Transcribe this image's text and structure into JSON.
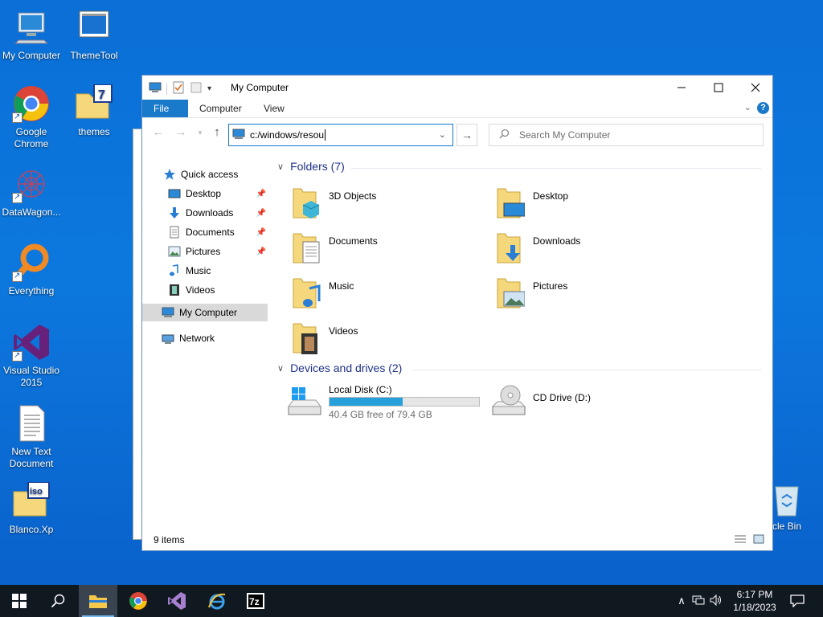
{
  "desktop": {
    "icons": [
      {
        "label": "My Computer"
      },
      {
        "label": "ThemeTool"
      },
      {
        "label": "Google Chrome"
      },
      {
        "label": "themes"
      },
      {
        "label": "DataWagon..."
      },
      {
        "label": "Everything"
      },
      {
        "label": "Visual Studio 2015"
      },
      {
        "label": "New Text Document"
      },
      {
        "label": "Blanco.Xp"
      },
      {
        "label": "Recycle Bin",
        "visible_text": "ycle Bin"
      }
    ]
  },
  "window": {
    "title": "My Computer",
    "ribbon_tabs": [
      "File",
      "Computer",
      "View"
    ],
    "address": "c:/windows/resou",
    "search_placeholder": "Search My Computer",
    "nav": {
      "quick_access": "Quick access",
      "items": [
        "Desktop",
        "Downloads",
        "Documents",
        "Pictures",
        "Music",
        "Videos"
      ],
      "my_computer": "My Computer",
      "network": "Network"
    },
    "folders_header": "Folders (7)",
    "folders": [
      "3D Objects",
      "Desktop",
      "Documents",
      "Downloads",
      "Music",
      "Pictures",
      "Videos"
    ],
    "drives_header": "Devices and drives (2)",
    "drives": [
      {
        "name": "Local Disk (C:)",
        "free": "40.4 GB free of 79.4 GB",
        "used_fraction": 0.49
      },
      {
        "name": "CD Drive (D:)"
      }
    ],
    "status": "9 items"
  },
  "taskbar": {
    "time": "6:17 PM",
    "date": "1/18/2023"
  },
  "colors": {
    "accent": "#1979ca",
    "desktop_bg": "#0c78de",
    "taskbar": "#101820",
    "group_header": "#1e3287"
  }
}
